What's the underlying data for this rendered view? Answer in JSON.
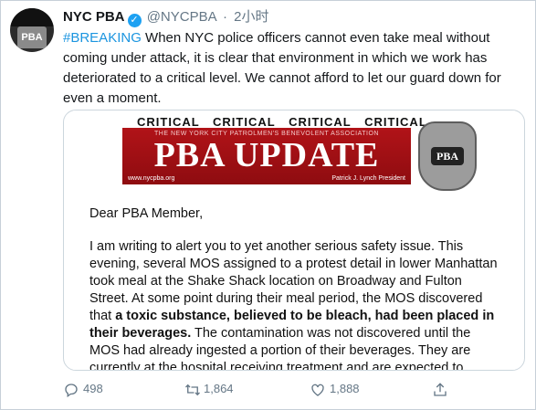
{
  "tweet": {
    "display_name": "NYC PBA",
    "handle": "@NYCPBA",
    "separator": "·",
    "time": "2小时",
    "verified_glyph": "✓",
    "hashtag": "#BREAKING",
    "text": " When NYC police officers cannot even take meal without coming under attack, it is clear that environment in which we work has deteriorated to a critical level. We cannot afford to let our guard down for even a moment."
  },
  "avatar": {
    "badge_text": "PBA"
  },
  "card": {
    "critical_row": "CRITICAL CRITICAL CRITICAL CRITICAL",
    "banner_subtitle": "THE NEW YORK CITY PATROLMEN'S BENEVOLENT ASSOCIATION",
    "banner_title": "PBA UPDATE",
    "banner_url": "www.nycpba.org",
    "banner_president": "Patrick J. Lynch President",
    "shield_text": "PBA",
    "greeting": "Dear PBA Member,",
    "body_pre": "I am writing to alert you to yet another serious safety issue. This evening, several MOS assigned to a protest detail in lower Manhattan took meal at the Shake Shack location on Broadway and Fulton Street. At some point during their meal period, the MOS discovered that ",
    "body_bold": "a toxic substance, believed to be bleach, had been placed in their beverages.",
    "body_post": " The contamination was not discovered until the MOS had already ingested a portion of their beverages. They are currently at the hospital receiving treatment and are expected to"
  },
  "actions": {
    "reply_count": "498",
    "retweet_count": "1,864",
    "like_count": "1,888",
    "icons": [
      "reply-icon",
      "retweet-icon",
      "like-icon",
      "share-icon"
    ]
  },
  "colors": {
    "hashtag": "#1b95e0",
    "banner_red": "#b11318",
    "verified_blue": "#1da1f2",
    "muted": "#657786"
  }
}
